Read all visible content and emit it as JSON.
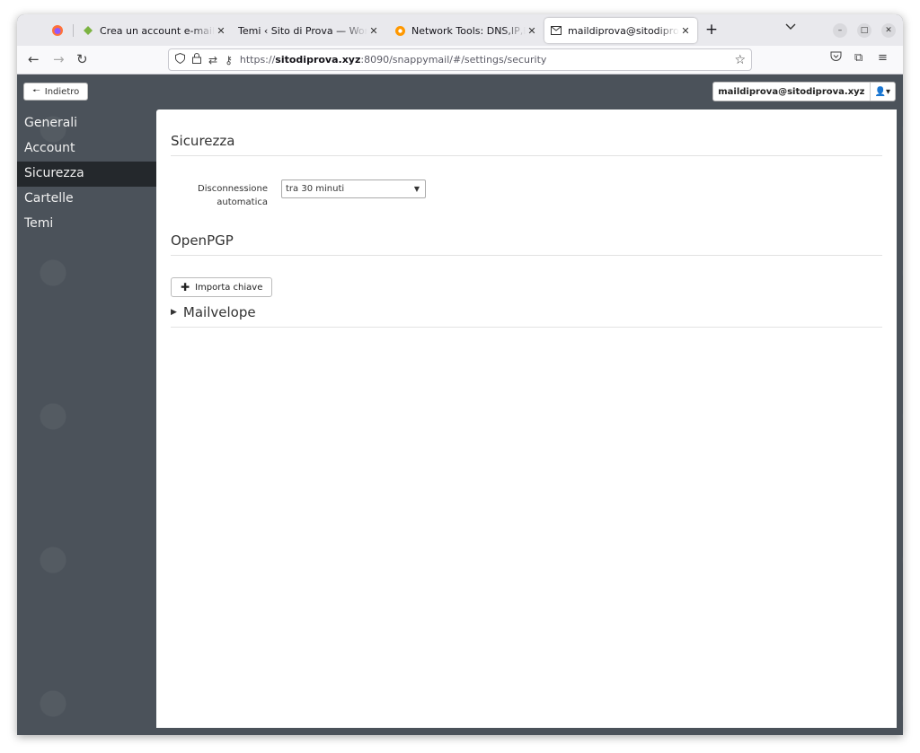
{
  "browser": {
    "tabs": [
      {
        "label": "Crea un account e-mail - cPanel",
        "icon": "cpanel-icon"
      },
      {
        "label": "Temi ‹ Sito di Prova — WordPress",
        "icon": "wordpress-icon"
      },
      {
        "label": "Network Tools: DNS,IP,Email",
        "icon": "network-tools-icon"
      },
      {
        "label": "maildiprova@sitodiprova.xyz",
        "icon": "mail-icon"
      }
    ],
    "url_prefix": "https://",
    "url_host": "sitodiprova.xyz",
    "url_rest": ":8090/snappymail/#/settings/security"
  },
  "app": {
    "back_label": "Indietro",
    "account_email": "maildiprova@sitodiprova.xyz",
    "menu": [
      "Generali",
      "Account",
      "Sicurezza",
      "Cartelle",
      "Temi"
    ],
    "selected_menu": "Sicurezza",
    "security": {
      "title": "Sicurezza",
      "autologout_label_1": "Disconnessione",
      "autologout_label_2": "automatica",
      "autologout_value": "tra 30 minuti"
    },
    "openpgp": {
      "title": "OpenPGP",
      "import_label": "Importa chiave",
      "mailvelope_label": "Mailvelope"
    }
  }
}
